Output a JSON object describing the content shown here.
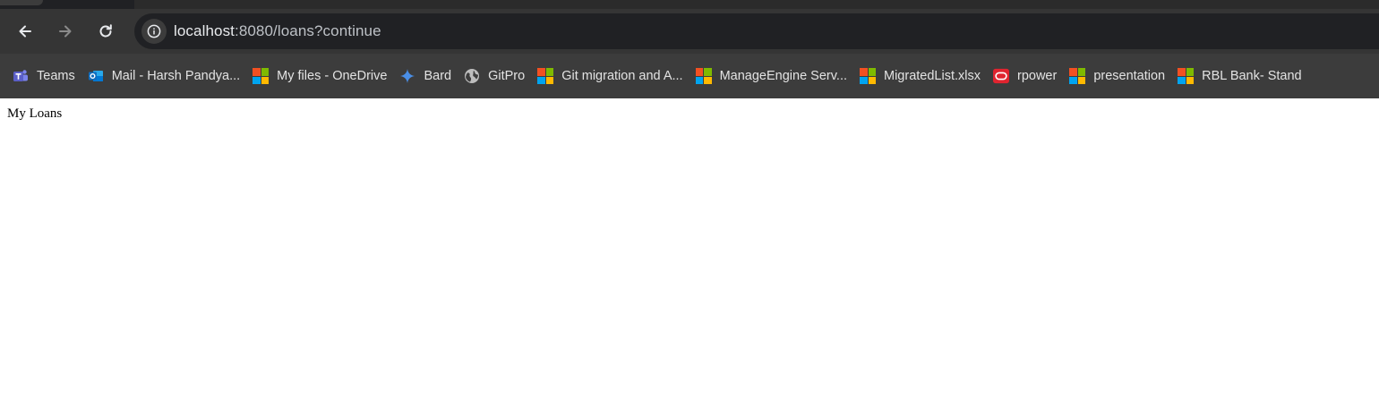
{
  "browser": {
    "url_host": "localhost",
    "url_rest": ":8080/loans?continue",
    "nav": {
      "back_icon": "back-arrow-icon",
      "forward_icon": "forward-arrow-icon",
      "reload_icon": "reload-icon"
    },
    "colors": {
      "ms_red": "#f25022",
      "ms_green": "#7fba00",
      "ms_blue": "#00a4ef",
      "ms_yellow": "#ffb900",
      "teams": "#5b5fc7",
      "outlook": "#0f6cbd",
      "oracle": "#e0242f"
    },
    "bookmarks": [
      {
        "label": "Teams",
        "icon": "teams-icon"
      },
      {
        "label": "Mail - Harsh Pandya...",
        "icon": "outlook-icon"
      },
      {
        "label": "My files - OneDrive",
        "icon": "microsoft-icon"
      },
      {
        "label": "Bard",
        "icon": "bard-sparkle-icon"
      },
      {
        "label": "GitPro",
        "icon": "globe-icon"
      },
      {
        "label": "Git migration and A...",
        "icon": "microsoft-icon"
      },
      {
        "label": "ManageEngine Serv...",
        "icon": "microsoft-icon"
      },
      {
        "label": "MigratedList.xlsx",
        "icon": "microsoft-icon"
      },
      {
        "label": "rpower",
        "icon": "oracle-icon"
      },
      {
        "label": "presentation",
        "icon": "microsoft-icon"
      },
      {
        "label": "RBL Bank- Stand",
        "icon": "microsoft-icon"
      }
    ]
  },
  "page": {
    "text": "My Loans"
  }
}
